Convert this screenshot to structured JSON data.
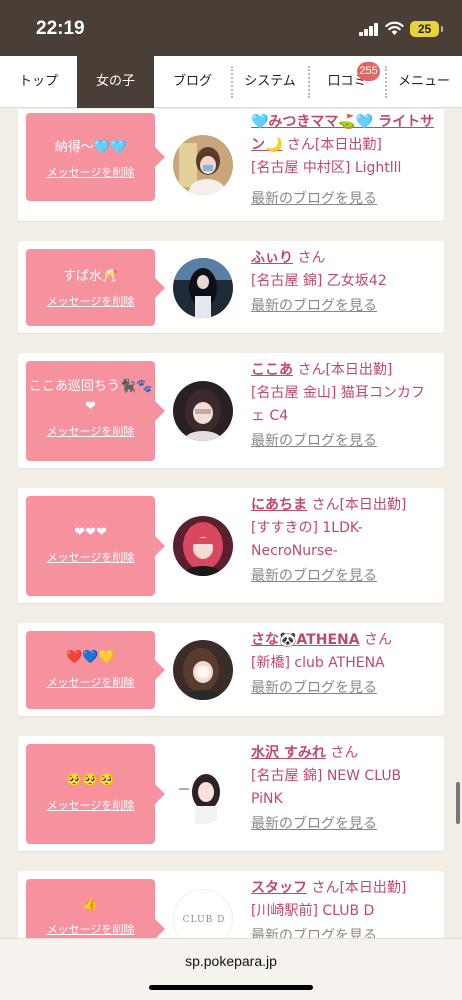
{
  "status": {
    "time": "22:19",
    "battery": "25"
  },
  "tabs": [
    {
      "label": "トップ"
    },
    {
      "label": "女の子"
    },
    {
      "label": "ブログ"
    },
    {
      "label": "システム"
    },
    {
      "label": "口コミ"
    },
    {
      "label": "メニュー"
    }
  ],
  "reviews_badge": "255",
  "delete_label": "メッセージを削除",
  "blog_label": "最新のブログを見る",
  "cards": [
    {
      "message": "納得〜🩵🩵",
      "name": "🩵みつきママ⛳🩵 ライトサン🌙",
      "suffix": "さん[本日出勤]",
      "shop": "[名古屋 中村区] Lightlll"
    },
    {
      "message": "すば水🥂",
      "name": "ふぃり",
      "suffix": "さん",
      "shop": "[名古屋 錦] 乙女坂42"
    },
    {
      "message": "ここあ巡回ちう🐈‍⬛🐾❤",
      "name": "ここあ",
      "suffix": "さん[本日出勤]",
      "shop": "[名古屋 金山] 猫耳コンカフェ C4"
    },
    {
      "message": "❤❤❤",
      "name": "にあちま",
      "suffix": "さん[本日出勤]",
      "shop": "[すすきの] 1LDK-NecroNurse-"
    },
    {
      "message": "❤️💙💛",
      "name": "さな🐼ATHENA",
      "suffix": "さん",
      "shop": "[新橋] club ATHENA"
    },
    {
      "message": "🥺🥺🥺",
      "name": "水沢 すみれ",
      "suffix": "さん",
      "shop": "[名古屋 錦] NEW CLUB PiNK"
    },
    {
      "message": "👍",
      "name": "スタッフ",
      "suffix": "さん[本日出勤]",
      "shop": "[川崎駅前] CLUB D"
    }
  ],
  "avatar_logo_text": "CLUB D",
  "url": "sp.pokepara.jp",
  "colors": {
    "header": "#4a3f36",
    "message_bubble": "#f5929e",
    "name_text": "#c2486a",
    "badge": "#e26664"
  }
}
